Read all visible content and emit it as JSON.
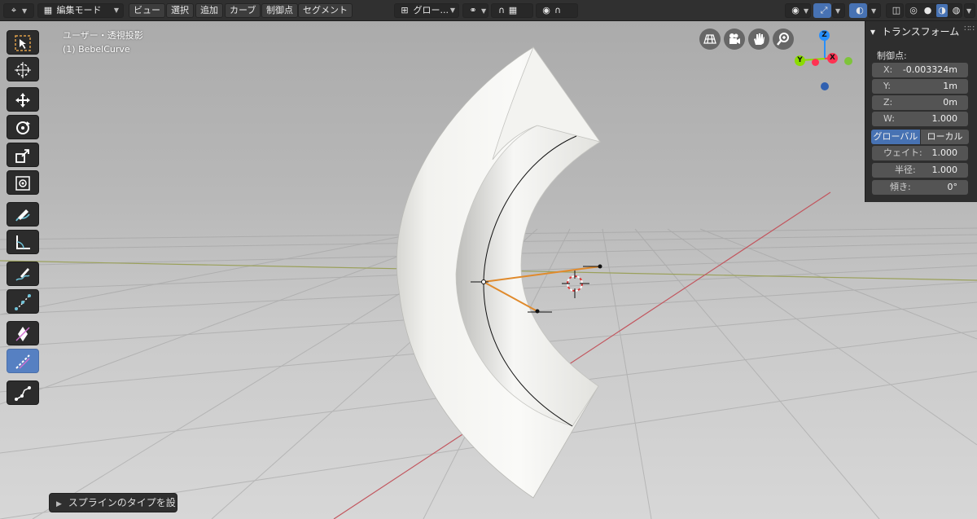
{
  "header": {
    "mode": "編集モード",
    "menus": [
      "ビュー",
      "選択",
      "追加",
      "カーブ",
      "制御点",
      "セグメント"
    ],
    "orientation": "グロー..."
  },
  "overlay": {
    "view_name": "ユーザー・透視投影",
    "object_name": "(1) BebelCurve"
  },
  "gizmo": {
    "z": "Z",
    "y": "Y",
    "x": "X"
  },
  "npanel": {
    "title": "トランスフォーム",
    "section": "制御点:",
    "x_label": "X:",
    "x_value": "-0.003324m",
    "y_label": "Y:",
    "y_value": "1m",
    "z_label": "Z:",
    "z_value": "0m",
    "w_label": "W:",
    "w_value": "1.000",
    "global": "グローバル",
    "local": "ローカル",
    "weight_label": "ウェイト:",
    "weight_value": "1.000",
    "radius_label": "半径:",
    "radius_value": "1.000",
    "tilt_label": "傾き:",
    "tilt_value": "0°"
  },
  "operator_panel": {
    "label": "スプラインのタイプを設"
  },
  "colors": {
    "accent": "#4772b3",
    "handle": "#e08a2c",
    "axis_x": "#ff3352",
    "axis_y": "#8bdc00",
    "axis_z": "#2890ff"
  }
}
